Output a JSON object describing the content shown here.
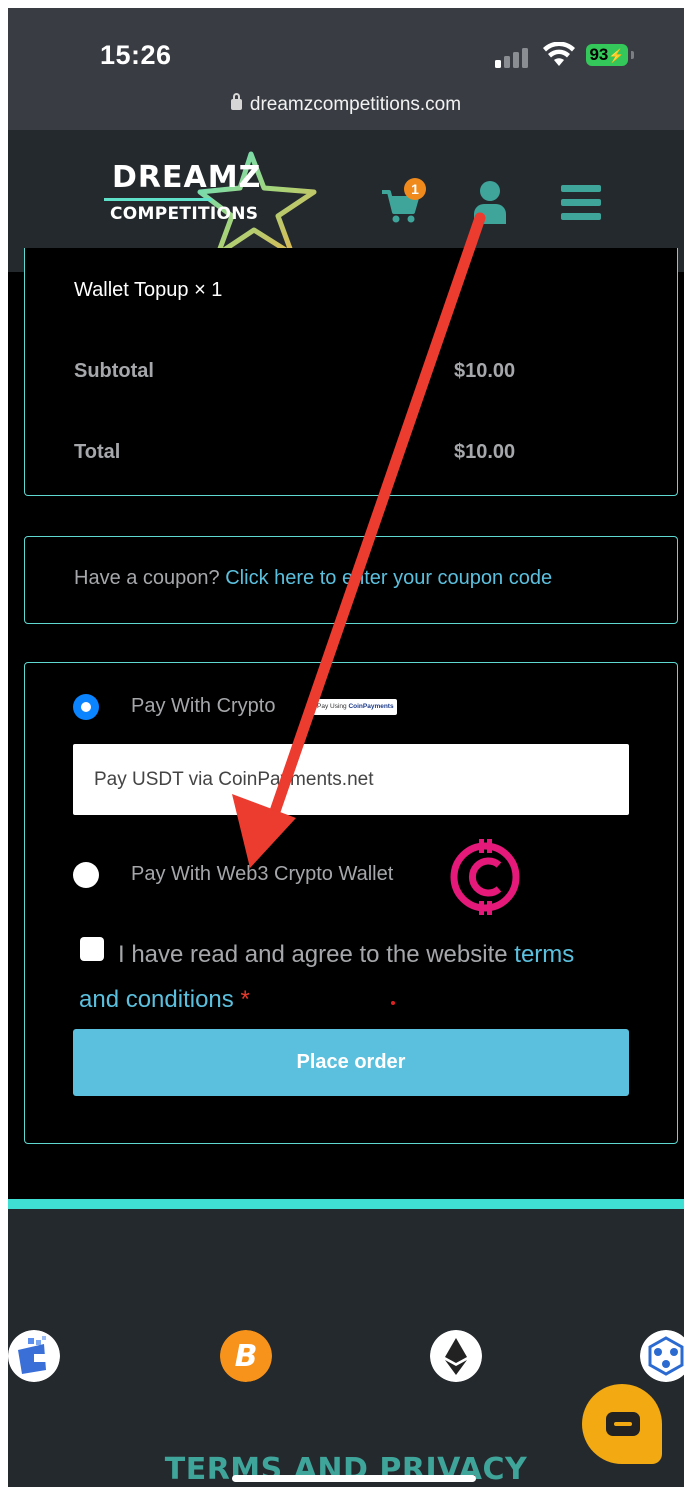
{
  "status_bar": {
    "time": "15:26",
    "battery": "93",
    "url": "dreamzcompetitions.com"
  },
  "header": {
    "logo_top": "DREAMZ",
    "logo_bottom": "COMPETITIONS",
    "cart_count": "1",
    "accent_color": "#3fa59b"
  },
  "order_summary": {
    "item": "Wallet Topup  × 1",
    "rows": [
      {
        "label": "Subtotal",
        "value": "$10.00"
      },
      {
        "label": "Total",
        "value": "$10.00"
      }
    ]
  },
  "coupon": {
    "prefix": "Have a coupon? ",
    "link": "Click here to enter your coupon code"
  },
  "payment": {
    "options": [
      {
        "label": "Pay With Crypto",
        "selected": true,
        "badge_prefix": "Pay Using",
        "badge_brand": "CoinPayments"
      },
      {
        "label": "Pay With Web3 Crypto Wallet",
        "selected": false
      }
    ],
    "description": "Pay USDT via CoinPayments.net",
    "terms_text": "I have read and agree to the website ",
    "terms_link_1": "terms",
    "terms_link_2": "and conditions",
    "required_mark": "*",
    "place_order": "Place order"
  },
  "footer": {
    "heading": "TERMS AND PRIVACY",
    "icons": [
      "wallet-app-icon",
      "bitcoin-icon",
      "ethereum-icon",
      "network-icon",
      "chat-icon"
    ]
  }
}
